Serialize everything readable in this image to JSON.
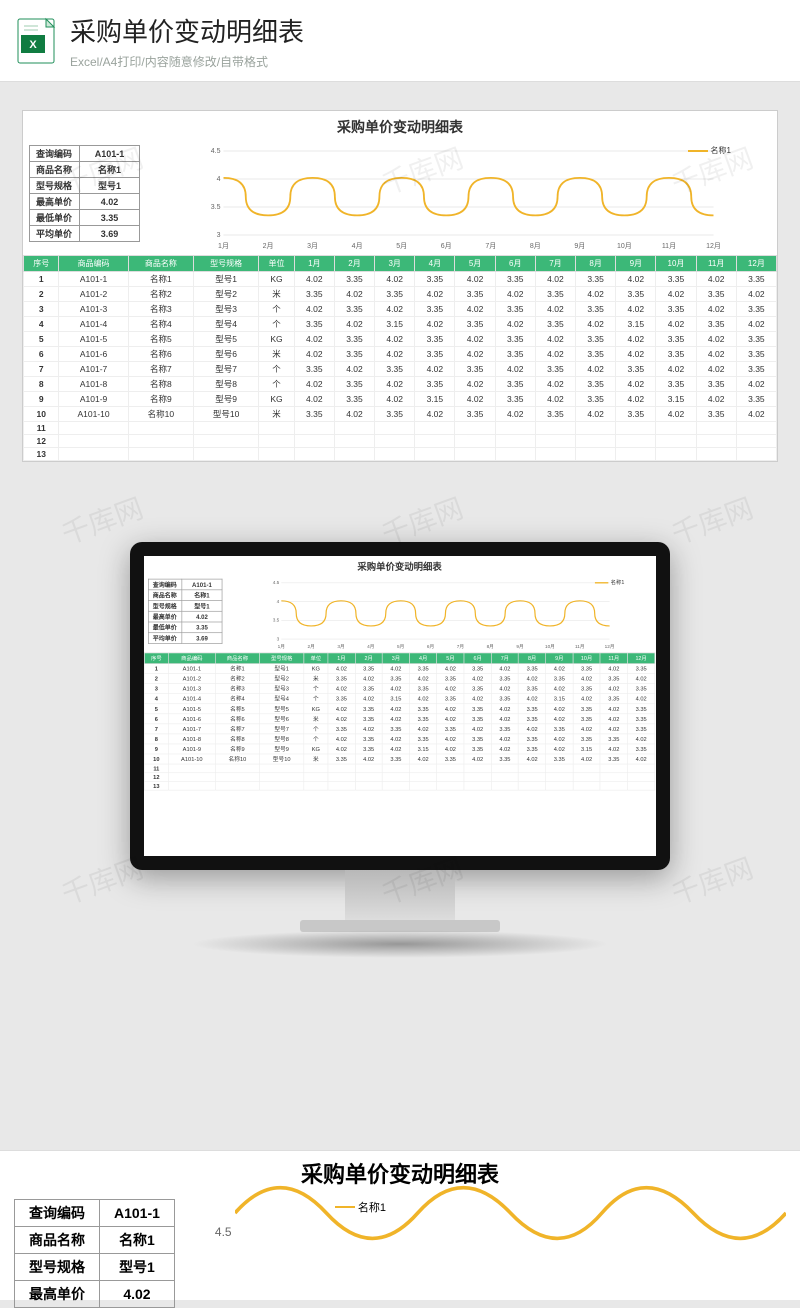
{
  "header": {
    "title": "采购单价变动明细表",
    "subtitle": "Excel/A4打印/内容随意修改/自带格式",
    "icon_label": "XLS"
  },
  "watermark_text": "千库网",
  "sheet": {
    "title": "采购单价变动明细表",
    "info_rows": [
      {
        "label": "查询编码",
        "value": "A101-1"
      },
      {
        "label": "商品名称",
        "value": "名称1"
      },
      {
        "label": "型号规格",
        "value": "型号1"
      },
      {
        "label": "最高单价",
        "value": "4.02"
      },
      {
        "label": "最低单价",
        "value": "3.35"
      },
      {
        "label": "平均单价",
        "value": "3.69"
      }
    ],
    "legend_series": "名称1",
    "columns": [
      "序号",
      "商品编码",
      "商品名称",
      "型号规格",
      "单位",
      "1月",
      "2月",
      "3月",
      "4月",
      "5月",
      "6月",
      "7月",
      "8月",
      "9月",
      "10月",
      "11月",
      "12月"
    ],
    "rows": [
      {
        "no": "1",
        "code": "A101-1",
        "name": "名称1",
        "spec": "型号1",
        "unit": "KG",
        "m": [
          "4.02",
          "3.35",
          "4.02",
          "3.35",
          "4.02",
          "3.35",
          "4.02",
          "3.35",
          "4.02",
          "3.35",
          "4.02",
          "3.35"
        ]
      },
      {
        "no": "2",
        "code": "A101-2",
        "name": "名称2",
        "spec": "型号2",
        "unit": "米",
        "m": [
          "3.35",
          "4.02",
          "3.35",
          "4.02",
          "3.35",
          "4.02",
          "3.35",
          "4.02",
          "3.35",
          "4.02",
          "3.35",
          "4.02"
        ]
      },
      {
        "no": "3",
        "code": "A101-3",
        "name": "名称3",
        "spec": "型号3",
        "unit": "个",
        "m": [
          "4.02",
          "3.35",
          "4.02",
          "3.35",
          "4.02",
          "3.35",
          "4.02",
          "3.35",
          "4.02",
          "3.35",
          "4.02",
          "3.35"
        ]
      },
      {
        "no": "4",
        "code": "A101-4",
        "name": "名称4",
        "spec": "型号4",
        "unit": "个",
        "m": [
          "3.35",
          "4.02",
          "3.15",
          "4.02",
          "3.35",
          "4.02",
          "3.35",
          "4.02",
          "3.15",
          "4.02",
          "3.35",
          "4.02"
        ]
      },
      {
        "no": "5",
        "code": "A101-5",
        "name": "名称5",
        "spec": "型号5",
        "unit": "KG",
        "m": [
          "4.02",
          "3.35",
          "4.02",
          "3.35",
          "4.02",
          "3.35",
          "4.02",
          "3.35",
          "4.02",
          "3.35",
          "4.02",
          "3.35"
        ]
      },
      {
        "no": "6",
        "code": "A101-6",
        "name": "名称6",
        "spec": "型号6",
        "unit": "米",
        "m": [
          "4.02",
          "3.35",
          "4.02",
          "3.35",
          "4.02",
          "3.35",
          "4.02",
          "3.35",
          "4.02",
          "3.35",
          "4.02",
          "3.35"
        ]
      },
      {
        "no": "7",
        "code": "A101-7",
        "name": "名称7",
        "spec": "型号7",
        "unit": "个",
        "m": [
          "3.35",
          "4.02",
          "3.35",
          "4.02",
          "3.35",
          "4.02",
          "3.35",
          "4.02",
          "3.35",
          "4.02",
          "4.02",
          "3.35"
        ]
      },
      {
        "no": "8",
        "code": "A101-8",
        "name": "名称8",
        "spec": "型号8",
        "unit": "个",
        "m": [
          "4.02",
          "3.35",
          "4.02",
          "3.35",
          "4.02",
          "3.35",
          "4.02",
          "3.35",
          "4.02",
          "3.35",
          "3.35",
          "4.02"
        ]
      },
      {
        "no": "9",
        "code": "A101-9",
        "name": "名称9",
        "spec": "型号9",
        "unit": "KG",
        "m": [
          "4.02",
          "3.35",
          "4.02",
          "3.15",
          "4.02",
          "3.35",
          "4.02",
          "3.35",
          "4.02",
          "3.15",
          "4.02",
          "3.35"
        ]
      },
      {
        "no": "10",
        "code": "A101-10",
        "name": "名称10",
        "spec": "型号10",
        "unit": "米",
        "m": [
          "3.35",
          "4.02",
          "3.35",
          "4.02",
          "3.35",
          "4.02",
          "3.35",
          "4.02",
          "3.35",
          "4.02",
          "3.35",
          "4.02"
        ]
      }
    ],
    "blank_rows": [
      "11",
      "12",
      "13"
    ]
  },
  "chart_data": {
    "type": "line",
    "title": "采购单价变动明细表",
    "series": [
      {
        "name": "名称1",
        "values": [
          4.02,
          3.35,
          4.02,
          3.35,
          4.02,
          3.35,
          4.02,
          3.35,
          4.02,
          3.35,
          4.02,
          3.35
        ]
      }
    ],
    "categories": [
      "1月",
      "2月",
      "3月",
      "4月",
      "5月",
      "6月",
      "7月",
      "8月",
      "9月",
      "10月",
      "11月",
      "12月"
    ],
    "ylim": [
      3,
      4.5
    ],
    "yticks": [
      3,
      3.5,
      4,
      4.5
    ],
    "xlabel": "",
    "ylabel": ""
  },
  "bottom": {
    "info_rows_partial": [
      {
        "label": "查询编码",
        "value": "A101-1"
      },
      {
        "label": "商品名称",
        "value": "名称1"
      },
      {
        "label": "型号规格",
        "value": "型号1"
      },
      {
        "label": "最高单价",
        "value": "4.02"
      }
    ],
    "y_tick": "4.5"
  }
}
